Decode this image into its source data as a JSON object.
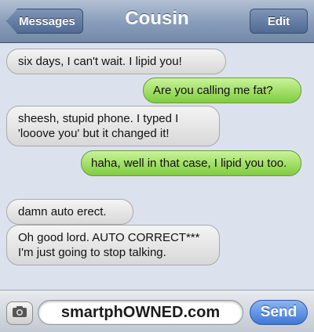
{
  "header": {
    "back_label": "Messages",
    "title": "Cousin",
    "edit_label": "Edit"
  },
  "messages": [
    {
      "from": "them",
      "text": "six days, I can't wait. I lipid you!"
    },
    {
      "from": "me",
      "text": "Are you calling me fat?"
    },
    {
      "from": "them",
      "text": "sheesh, stupid phone. I typed I 'looove you' but it changed it!"
    },
    {
      "from": "me",
      "text": "haha, well in that case, I lipid you too."
    },
    {
      "from": "them",
      "text": "damn auto erect."
    },
    {
      "from": "them",
      "text": "Oh good lord. AUTO CORRECT*** I'm just going to stop talking."
    }
  ],
  "composer": {
    "input_value": "smartphOWNED.com",
    "send_label": "Send",
    "camera_icon": "camera-icon"
  },
  "colors": {
    "sent_bubble": "#8fd64a",
    "received_bubble": "#e6e6e6",
    "navbar": "#8b9fbc",
    "send_button": "#3f78d6"
  }
}
